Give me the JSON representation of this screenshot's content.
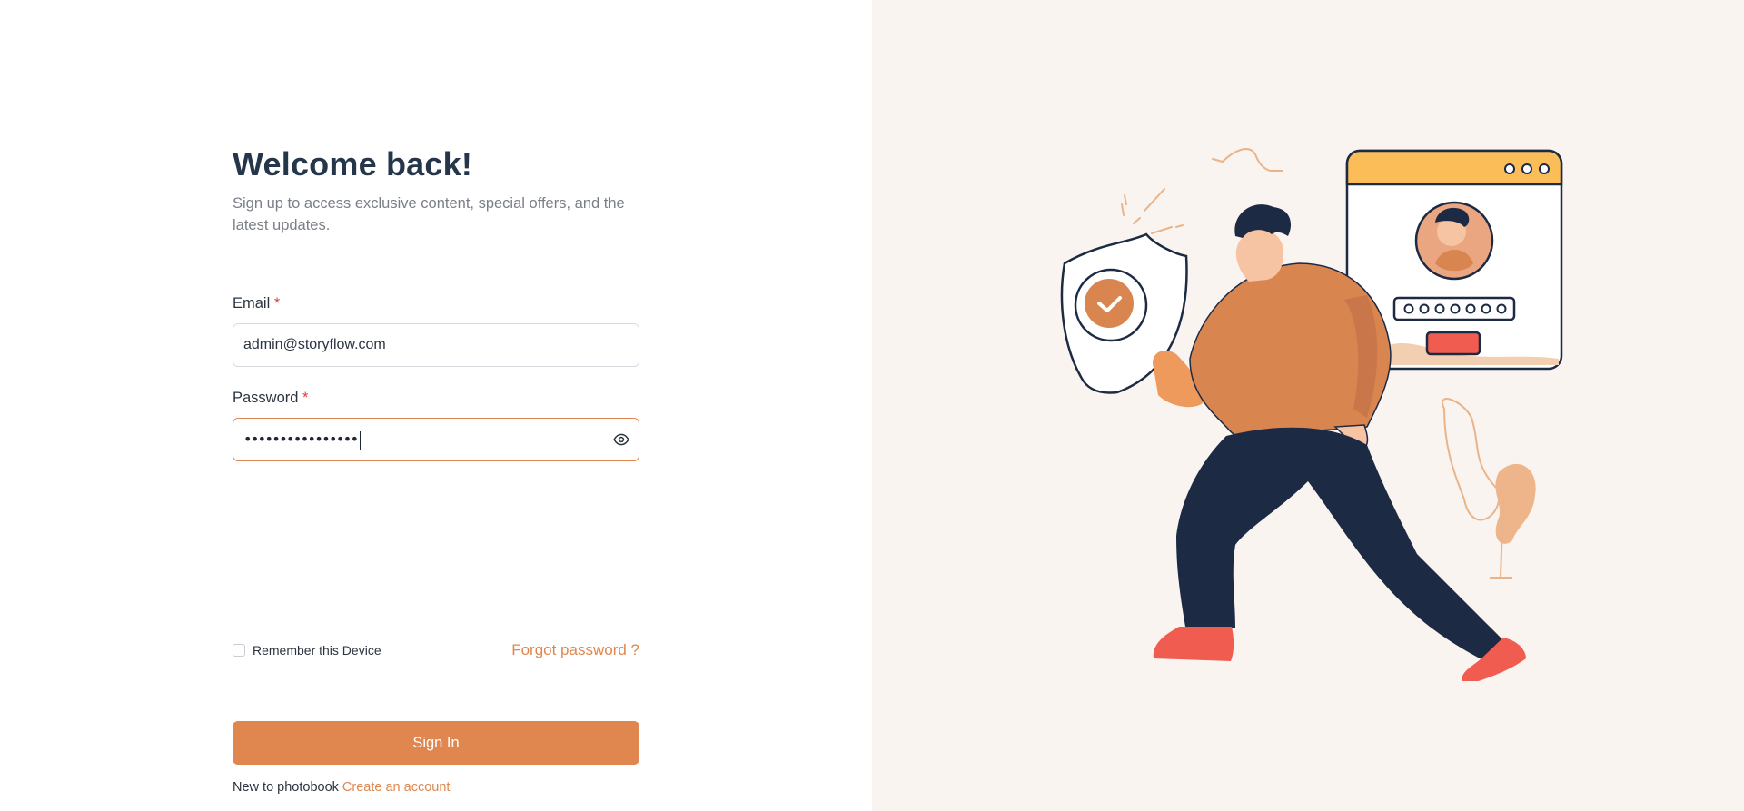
{
  "login": {
    "title": "Welcome back!",
    "subtitle": "Sign up to access exclusive content, special offers, and the latest updates.",
    "email": {
      "label": "Email",
      "required_mark": "*",
      "value": "admin@storyflow.com"
    },
    "password": {
      "label": "Password",
      "required_mark": "*",
      "masked_value": "••••••••••••••••",
      "toggle_icon": "eye-icon"
    },
    "remember_label": "Remember this Device",
    "forgot_label": "Forgot password ?",
    "signin_label": "Sign In",
    "new_to_text": "New to photobook",
    "create_account_label": "Create an account"
  },
  "colors": {
    "accent": "#df874f",
    "heading": "#25364a",
    "muted": "#7a7f87",
    "panel_bg": "#f9f4ef",
    "required": "#e23b3b"
  }
}
